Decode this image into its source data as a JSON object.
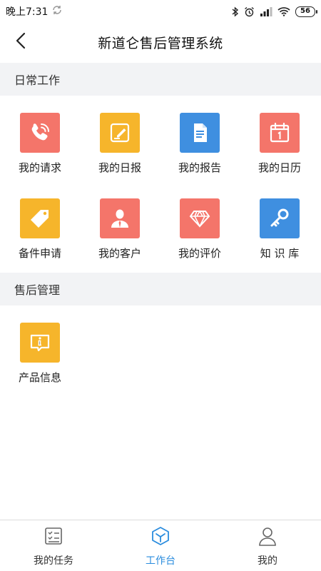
{
  "status_bar": {
    "time": "晚上7:31",
    "battery": "56"
  },
  "nav": {
    "title": "新道仑售后管理系统"
  },
  "sections": [
    {
      "title": "日常工作",
      "items": [
        {
          "label": "我的请求",
          "icon": "phone-icon",
          "color": "#f4756a"
        },
        {
          "label": "我的日报",
          "icon": "note-pencil-icon",
          "color": "#f6b52b"
        },
        {
          "label": "我的报告",
          "icon": "document-icon",
          "color": "#3f8fe0"
        },
        {
          "label": "我的日历",
          "icon": "calendar-icon",
          "color": "#f4756a"
        },
        {
          "label": "备件申请",
          "icon": "tag-icon",
          "color": "#f6b52b"
        },
        {
          "label": "我的客户",
          "icon": "person-icon",
          "color": "#f4756a"
        },
        {
          "label": "我的评价",
          "icon": "diamond-icon",
          "color": "#f4756a"
        },
        {
          "label": "知 识 库",
          "icon": "key-icon",
          "color": "#3f8fe0"
        }
      ]
    },
    {
      "title": "售后管理",
      "items": [
        {
          "label": "产品信息",
          "icon": "info-chat-icon",
          "color": "#f6b52b"
        }
      ]
    }
  ],
  "tab_bar": {
    "tabs": [
      {
        "label": "我的任务",
        "icon": "task-list-icon",
        "active": false
      },
      {
        "label": "工作台",
        "icon": "cube-icon",
        "active": true
      },
      {
        "label": "我的",
        "icon": "user-icon",
        "active": false
      }
    ],
    "active_color": "#2a8cde",
    "inactive_color": "#555555"
  }
}
